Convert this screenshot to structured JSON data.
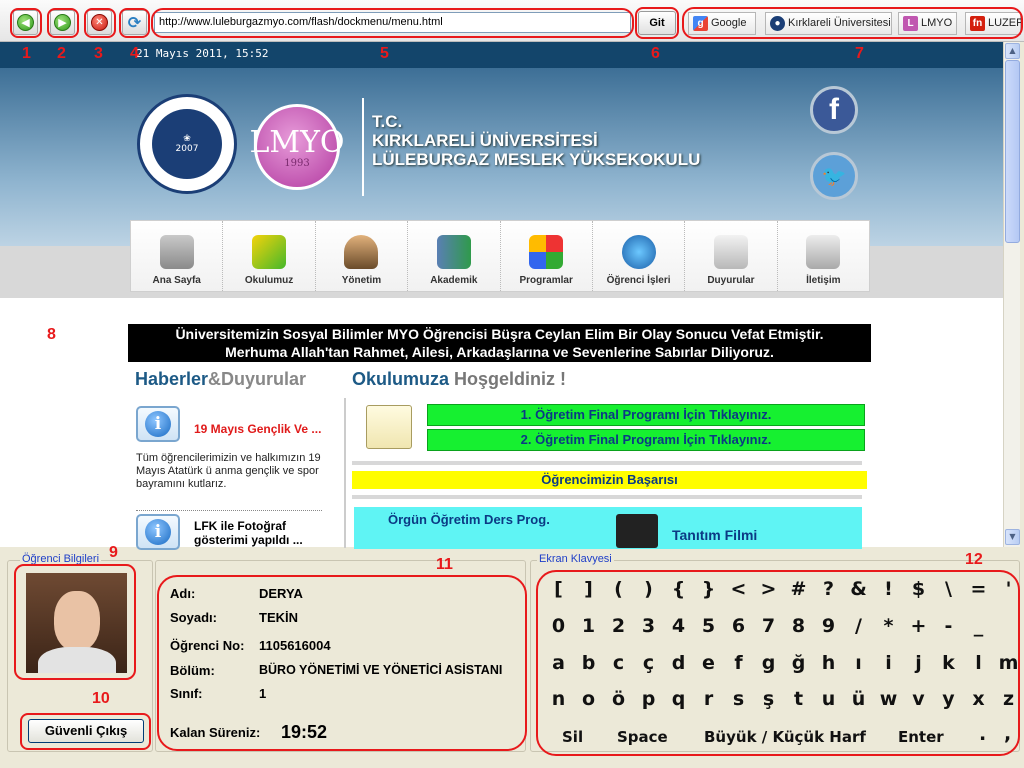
{
  "toolbar": {
    "url": "http://www.luleburgazmyo.com/flash/dockmenu/menu.html",
    "go_label": "Git",
    "bookmarks": [
      {
        "label": "Google",
        "icon": "google-icon"
      },
      {
        "label": "Kırklareli Üniversitesi",
        "icon": "university-icon"
      },
      {
        "label": "LMYO",
        "icon": "lmyo-icon"
      },
      {
        "label": "LUZEP",
        "icon": "luzep-icon"
      }
    ]
  },
  "annotations": [
    "1",
    "2",
    "3",
    "4",
    "5",
    "6",
    "7",
    "8",
    "9",
    "10",
    "11",
    "12"
  ],
  "colors": {
    "annotation": "#e8191b",
    "header_navy": "#13456b",
    "green_bar": "#16f030",
    "yellow_bar": "#fffd00",
    "cyan_box": "#5ff4f4"
  },
  "page": {
    "date": "21 Mayıs 2011, 15:52",
    "school_title": [
      "T.C.",
      "KIRKLARELİ ÜNİVERSİTESİ",
      "LÜLEBURGAZ MESLEK YÜKSEKOKULU"
    ],
    "seal_text": "KIRKLARELİ ÜNİVERSİTESİ 2007",
    "lmyo_logo": {
      "text": "LMYO",
      "year": "1993"
    },
    "menu": [
      "Ana Sayfa",
      "Okulumuz",
      "Yönetim",
      "Akademik",
      "Programlar",
      "Öğrenci İşleri",
      "Duyurular",
      "İletişim"
    ],
    "announcement": [
      "Üniversitemizin Sosyal Bilimler MYO Öğrencisi Büşra Ceylan Elim Bir Olay Sonucu Vefat Etmiştir.",
      "Merhuma Allah'tan Rahmet, Ailesi, Arkadaşlarına ve Sevenlerine Sabırlar Diliyoruz."
    ],
    "news_heading": {
      "part1": "Haberler",
      "part2": "&Duyurular"
    },
    "welcome_heading": {
      "part1": "Okulumuza",
      "part2": " Hoşgeldiniz !"
    },
    "news": [
      {
        "title": "19 Mayıs Gençlik Ve ...",
        "body": "Tüm öğrencilerimizin ve halkımızın 19 Mayıs Atatürk ü anma gençlik ve spor bayramını kutlarız."
      },
      {
        "title": "LFK ile Fotoğraf gösterimi yapıldı ...",
        "body": ""
      }
    ],
    "program_links": [
      "1. Öğretim Final Programı İçin Tıklayınız.",
      "2. Öğretim Final Programı İçin Tıklayınız."
    ],
    "success_label": "Öğrencimizin Başarısı",
    "schedule_label": "Örgün Öğretim Ders Prog.",
    "film_label": "Tanıtım Filmi"
  },
  "student": {
    "panel_label": "Öğrenci Bilgileri",
    "exit_label": "Güvenli Çıkış",
    "fields": [
      {
        "label": "Adı:",
        "value": "DERYA"
      },
      {
        "label": "Soyadı:",
        "value": "TEKİN"
      },
      {
        "label": "Öğrenci No:",
        "value": "1105616004"
      },
      {
        "label": "Bölüm:",
        "value": "BÜRO YÖNETİMİ VE YÖNETİCİ ASİSTANI"
      },
      {
        "label": "Sınıf:",
        "value": "1"
      }
    ],
    "remaining_label": "Kalan Süreniz:",
    "remaining_value": "19:52"
  },
  "keyboard": {
    "panel_label": "Ekran Klavyesi",
    "rows": [
      [
        "[",
        "]",
        "(",
        ")",
        "{",
        "}",
        "<",
        ">",
        "#",
        "?",
        "&",
        "!",
        "$",
        "\\",
        "=",
        "'"
      ],
      [
        "0",
        "1",
        "2",
        "3",
        "4",
        "5",
        "6",
        "7",
        "8",
        "9",
        "/",
        "*",
        "+",
        "-",
        "_"
      ],
      [
        "a",
        "b",
        "c",
        "ç",
        "d",
        "e",
        "f",
        "g",
        "ğ",
        "h",
        "ı",
        "i",
        "j",
        "k",
        "l",
        "m",
        "|"
      ],
      [
        "n",
        "o",
        "ö",
        "p",
        "q",
        "r",
        "s",
        "ş",
        "t",
        "u",
        "ü",
        "w",
        "v",
        "y",
        "x",
        "z",
        ":",
        ";"
      ]
    ],
    "bottom": [
      "Sil",
      "Space",
      "Büyük / Küçük Harf",
      "Enter",
      ".",
      ","
    ]
  }
}
